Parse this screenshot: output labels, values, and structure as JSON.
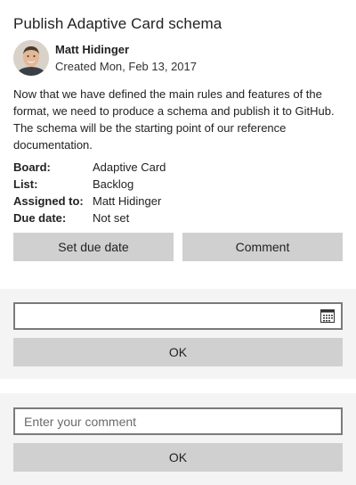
{
  "card": {
    "title": "Publish Adaptive Card schema",
    "author": "Matt Hidinger",
    "created": "Created Mon, Feb 13, 2017",
    "description": "Now that we have defined the main rules and features of the format, we need to produce a schema and publish it to GitHub. The schema will be the starting point of our reference documentation.",
    "facts": [
      {
        "key": "Board:",
        "value": "Adaptive Card"
      },
      {
        "key": "List:",
        "value": "Backlog"
      },
      {
        "key": "Assigned to:",
        "value": "Matt Hidinger"
      },
      {
        "key": "Due date:",
        "value": "Not set"
      }
    ],
    "actions": {
      "set_due_date_label": "Set due date",
      "comment_label": "Comment"
    }
  },
  "due_date_panel": {
    "date_value": "",
    "ok_label": "OK",
    "icon": "calendar-icon"
  },
  "comment_panel": {
    "placeholder": "Enter your comment",
    "value": "",
    "ok_label": "OK"
  },
  "colors": {
    "button_bg": "#d0d0d0",
    "panel_bg": "#f4f4f4",
    "input_border": "#7a7a7a"
  }
}
